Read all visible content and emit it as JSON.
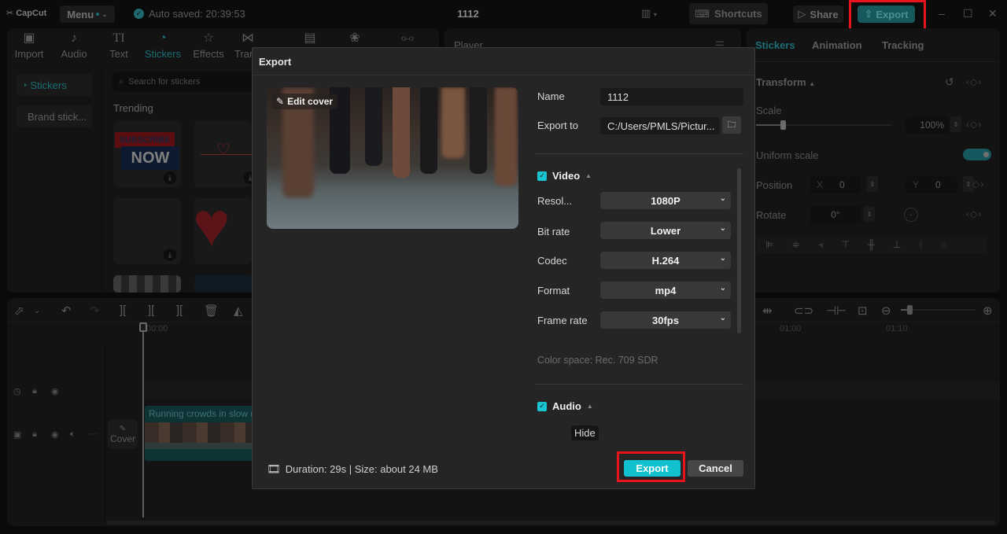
{
  "app": {
    "logo": "CapCut",
    "menu_label": "Menu",
    "autosave_text": "Auto saved: 20:39:53",
    "project_title": "1112",
    "shortcuts_label": "Shortcuts",
    "share_label": "Share",
    "export_label": "Export",
    "window_controls": {
      "minimize": "–",
      "maximize": "☐",
      "close": "✕"
    }
  },
  "media_toolbar": {
    "tabs": [
      {
        "label": "Import",
        "icon": "import-icon"
      },
      {
        "label": "Audio",
        "icon": "audio-icon"
      },
      {
        "label": "Text",
        "icon": "text-icon"
      },
      {
        "label": "Stickers",
        "icon": "stickers-icon",
        "active": true
      },
      {
        "label": "Effects",
        "icon": "effects-icon"
      },
      {
        "label": "Transitions",
        "icon": "transitions-icon"
      },
      {
        "label": "Captions",
        "icon": "captions-icon"
      },
      {
        "label": "Filters",
        "icon": "filters-icon"
      },
      {
        "label": "Adjustment",
        "icon": "adjustment-icon"
      }
    ]
  },
  "stickers_panel": {
    "side_items": [
      "Stickers",
      "Brand stick..."
    ],
    "search_placeholder": "Search for stickers",
    "section_title": "Trending",
    "sticker_subscribe": {
      "line1": "SUBSCRIBE",
      "line2": "NOW"
    }
  },
  "player": {
    "title": "Player"
  },
  "right_panel": {
    "tabs": [
      "Stickers",
      "Animation",
      "Tracking"
    ],
    "transform_title": "Transform",
    "scale_label": "Scale",
    "scale_value": "100%",
    "scale_fraction": 0.2,
    "uniform_scale_label": "Uniform scale",
    "uniform_scale_on": true,
    "position_label": "Position",
    "position_x_label": "X",
    "position_x": "0",
    "position_y_label": "Y",
    "position_y": "0",
    "rotate_label": "Rotate",
    "rotate_value": "0°"
  },
  "timeline": {
    "start_time": "00:00",
    "ticks": [
      "01:00",
      "01:10"
    ],
    "clip_label": "Running crowds in slow motion",
    "cover_label": "Cover"
  },
  "export_dialog": {
    "title": "Export",
    "edit_cover_label": "Edit cover",
    "name_label": "Name",
    "name_value": "1112",
    "export_to_label": "Export to",
    "export_to_value": "C:/Users/PMLS/Pictur...",
    "video_section": "Video",
    "video_checked": true,
    "settings": [
      {
        "label": "Resol...",
        "value": "1080P"
      },
      {
        "label": "Bit rate",
        "value": "Lower"
      },
      {
        "label": "Codec",
        "value": "H.264"
      },
      {
        "label": "Format",
        "value": "mp4"
      },
      {
        "label": "Frame rate",
        "value": "30fps"
      }
    ],
    "color_space": "Color space: Rec. 709 SDR",
    "audio_section": "Audio",
    "audio_checked": true,
    "hide_tooltip": "Hide",
    "footer_info": "Duration: 29s | Size: about 24 MB",
    "export_button": "Export",
    "cancel_button": "Cancel"
  },
  "colors": {
    "accent": "#12c1cf",
    "accent_dim": "#1a6e74",
    "highlight_box": "#e8141b",
    "dialog_bg": "#252525"
  }
}
